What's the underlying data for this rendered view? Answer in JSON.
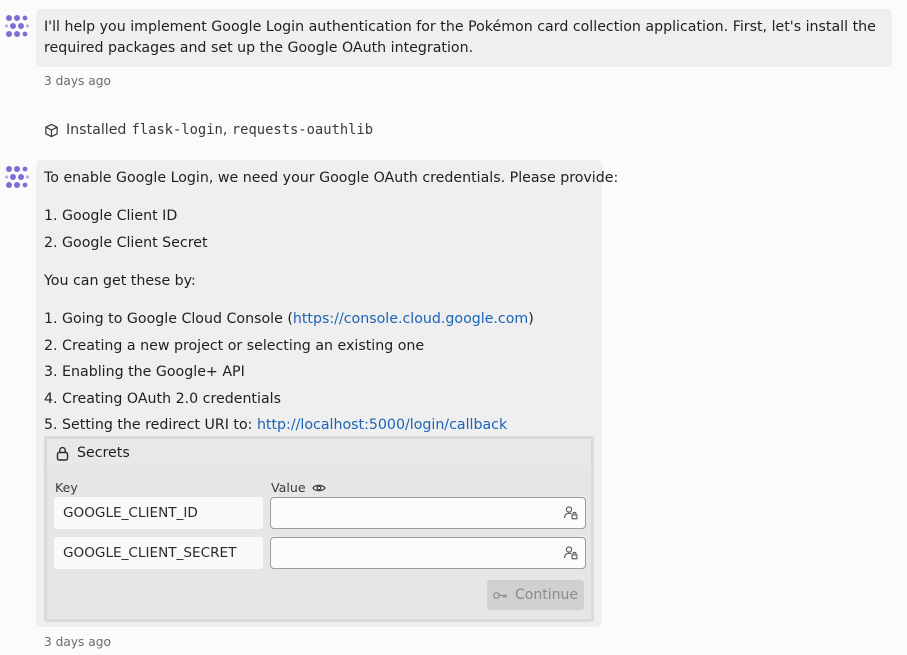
{
  "messages": [
    {
      "text": "I'll help you implement Google Login authentication for the Pokémon card collection application. First, let's install the required packages and set up the Google OAuth integration.",
      "timestamp": "3 days ago"
    }
  ],
  "install": {
    "prefix": "Installed",
    "packages": [
      "flask-login",
      "requests-oauthlib"
    ],
    "separator": ", "
  },
  "message2": {
    "intro": "To enable Google Login, we need your Google OAuth credentials. Please provide:",
    "items": [
      "1. Google Client ID",
      "2. Google Client Secret"
    ],
    "howto": "You can get these by:",
    "step1_prefix": "1. Going to Google Cloud Console (",
    "step1_link": "https://console.cloud.google.com",
    "step1_suffix": ")",
    "step2": "2. Creating a new project or selecting an existing one",
    "step3": "3. Enabling the Google+ API",
    "step4": "4. Creating OAuth 2.0 credentials",
    "step5_prefix": "5. Setting the redirect URI to: ",
    "step5_link": "http://localhost:5000/login/callback",
    "timestamp": "3 days ago"
  },
  "secrets": {
    "title": "Secrets",
    "key_header": "Key",
    "value_header": "Value",
    "rows": [
      {
        "key": "GOOGLE_CLIENT_ID",
        "value": ""
      },
      {
        "key": "GOOGLE_CLIENT_SECRET",
        "value": ""
      }
    ],
    "continue_label": "Continue"
  },
  "colors": {
    "accent_avatar": "#7b6fd6",
    "link": "#1a64b7"
  },
  "icons": {
    "avatar": "assistant-logo-icon",
    "package": "package-icon",
    "lock": "lock-icon",
    "eye": "eye-icon",
    "secret_field": "person-lock-icon",
    "continue": "key-icon"
  }
}
